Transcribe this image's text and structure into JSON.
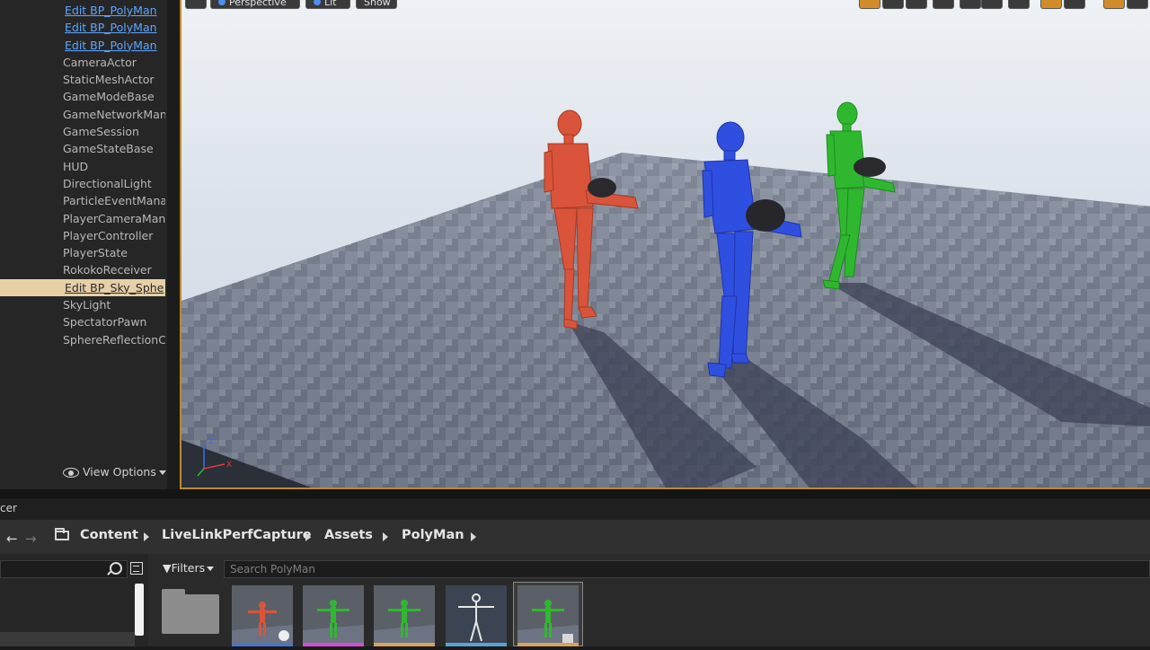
{
  "outliner": {
    "items": [
      {
        "label": "Edit BP_PolyMan",
        "kind": "link"
      },
      {
        "label": "Edit BP_PolyMan",
        "kind": "link"
      },
      {
        "label": "Edit BP_PolyMan",
        "kind": "link"
      },
      {
        "label": "CameraActor",
        "kind": "type"
      },
      {
        "label": "StaticMeshActor",
        "kind": "type"
      },
      {
        "label": "GameModeBase",
        "kind": "type"
      },
      {
        "label": "GameNetworkMana",
        "kind": "type"
      },
      {
        "label": "GameSession",
        "kind": "type"
      },
      {
        "label": "GameStateBase",
        "kind": "type"
      },
      {
        "label": "HUD",
        "kind": "type"
      },
      {
        "label": "DirectionalLight",
        "kind": "type"
      },
      {
        "label": "ParticleEventManag",
        "kind": "type"
      },
      {
        "label": "PlayerCameraMana",
        "kind": "type"
      },
      {
        "label": "PlayerController",
        "kind": "type"
      },
      {
        "label": "PlayerState",
        "kind": "type"
      },
      {
        "label": "RokokoReceiver",
        "kind": "type"
      },
      {
        "label": "Edit BP_Sky_Sphe",
        "kind": "link",
        "selected": true
      },
      {
        "label": "SkyLight",
        "kind": "type"
      },
      {
        "label": "SpectatorPawn",
        "kind": "type"
      },
      {
        "label": "SphereReflectionCa",
        "kind": "type"
      }
    ],
    "view_options": "View Options"
  },
  "viewport": {
    "toolbar": {
      "perspective": "Perspective",
      "lit": "Lit",
      "show": "Show"
    },
    "characters": [
      {
        "name": "red-polyman",
        "color": "#d9543a"
      },
      {
        "name": "blue-polyman",
        "color": "#2f4fe0"
      },
      {
        "name": "green-polyman",
        "color": "#2fb82f"
      }
    ]
  },
  "content_browser": {
    "tab_label": "cer",
    "breadcrumb": [
      "Content",
      "LiveLinkPerfCapture",
      "Assets",
      "PolyMan"
    ],
    "filters_label": "Filters",
    "search_placeholder": "Search PolyMan",
    "asset_strip_colors": [
      "#4a74c8",
      "#d24fd2",
      "#d9a25a",
      "#5aa0d8",
      "#d9a25a"
    ]
  }
}
